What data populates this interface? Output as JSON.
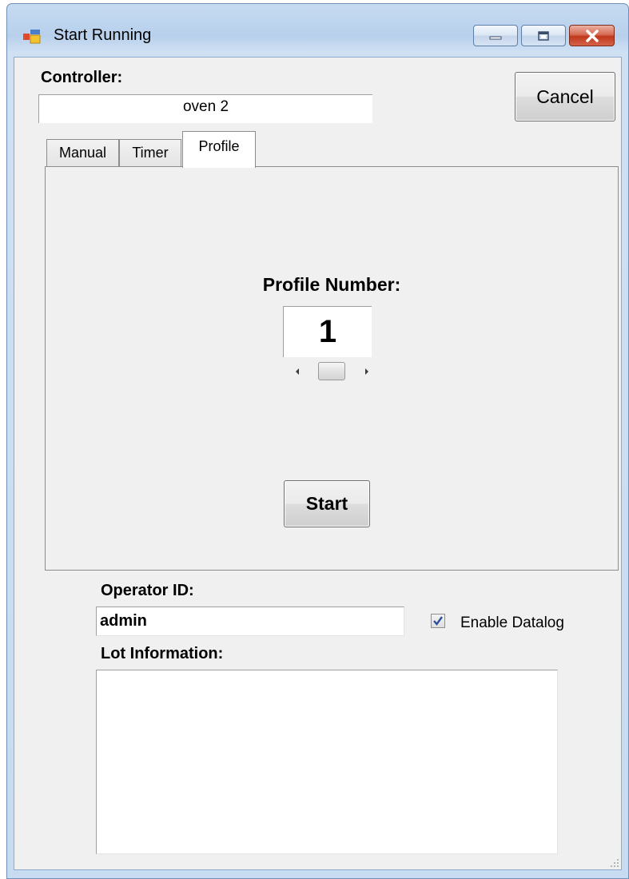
{
  "window": {
    "title": "Start Running",
    "icon": "app-form-icon",
    "buttons": {
      "minimize_icon": "minimize-icon",
      "maximize_icon": "maximize-icon",
      "close_icon": "close-icon"
    }
  },
  "controller": {
    "label": "Controller:",
    "value": "oven 2"
  },
  "cancel_label": "Cancel",
  "tabs": [
    {
      "label": "Manual",
      "selected": false
    },
    {
      "label": "Timer",
      "selected": false
    },
    {
      "label": "Profile",
      "selected": true
    }
  ],
  "profile": {
    "label": "Profile Number:",
    "value": "1",
    "start_label": "Start"
  },
  "operator": {
    "label": "Operator ID:",
    "value": "admin"
  },
  "datalog": {
    "label": "Enable Datalog",
    "checked": true
  },
  "lot": {
    "label": "Lot Information:",
    "value": ""
  },
  "colors": {
    "titlebar": "#c6dbf1",
    "client_bg": "#f0f0f0",
    "close_button": "#c0381c"
  }
}
